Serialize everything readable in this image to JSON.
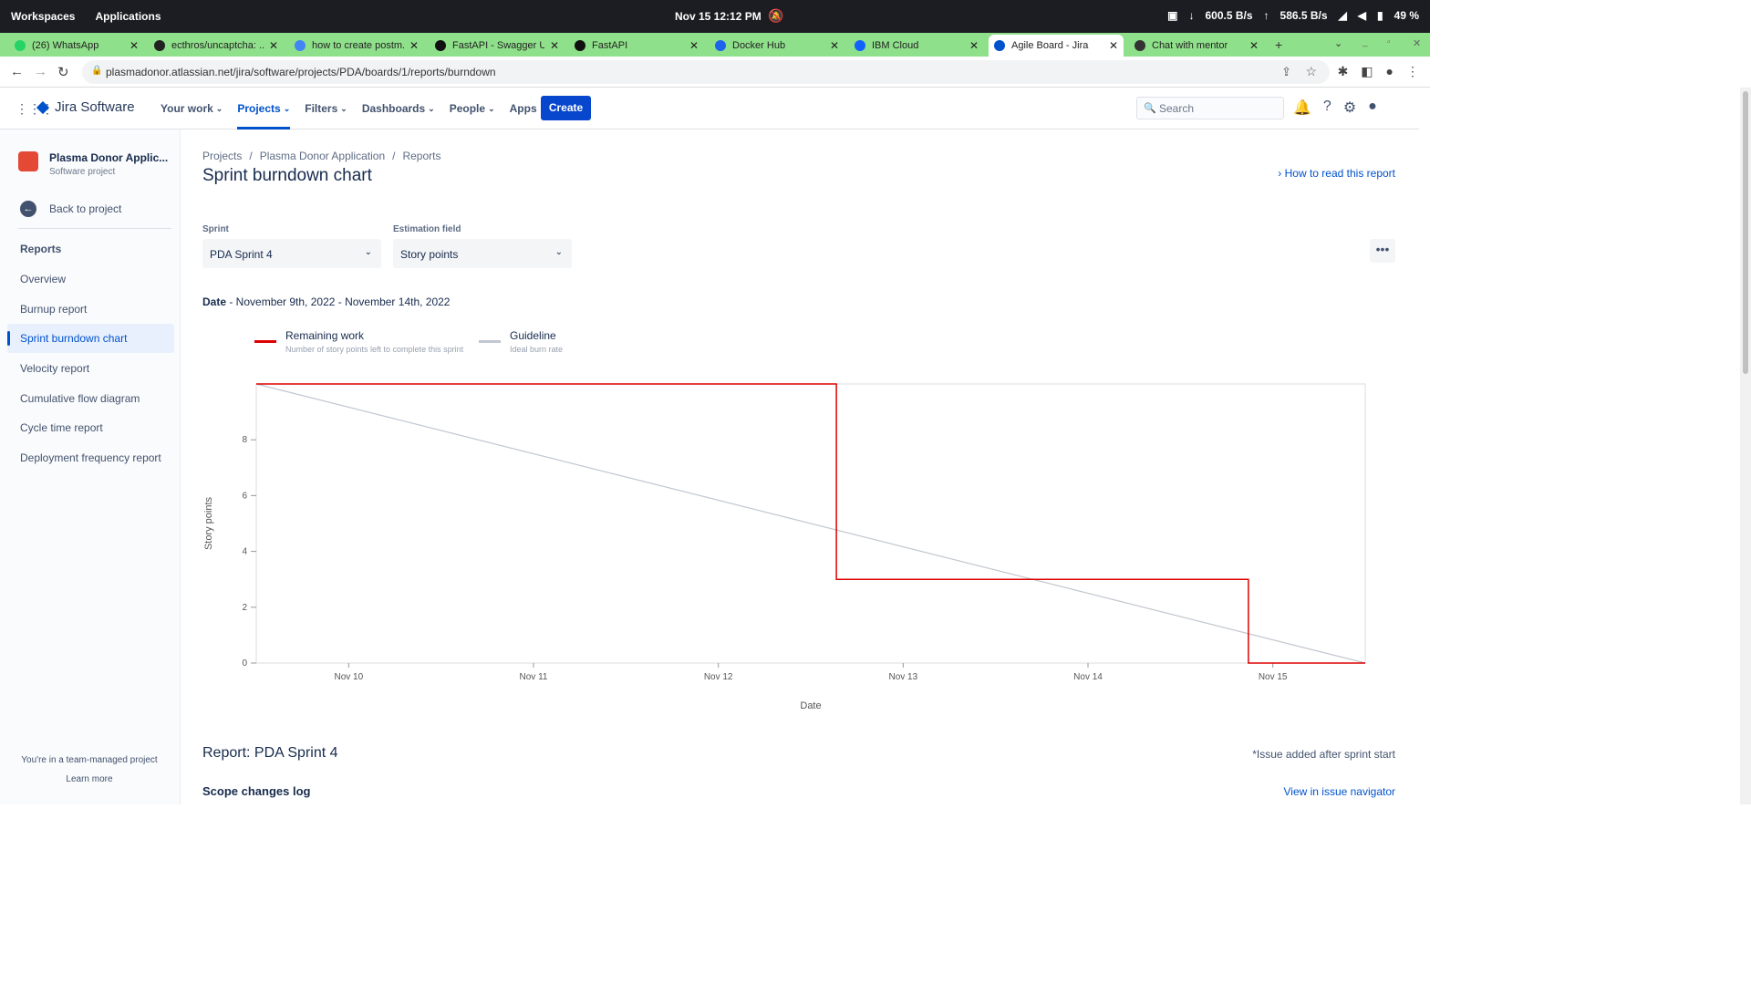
{
  "system": {
    "workspaces": "Workspaces",
    "applications": "Applications",
    "clock": "Nov 15  12:12 PM",
    "download": "600.5  B/s",
    "upload": "586.5  B/s",
    "battery": "49 %"
  },
  "tabs": [
    {
      "title": "(26) WhatsApp",
      "color": "#25d366"
    },
    {
      "title": "ecthros/uncaptcha: ...",
      "color": "#222222"
    },
    {
      "title": "how to create postm...",
      "color": "#4285f4"
    },
    {
      "title": "FastAPI - Swagger UI",
      "color": "#111111"
    },
    {
      "title": "FastAPI",
      "color": "#111111"
    },
    {
      "title": "Docker Hub",
      "color": "#1d63ed"
    },
    {
      "title": "IBM Cloud",
      "color": "#0f62fe"
    },
    {
      "title": "Agile Board - Jira",
      "color": "#0052cc"
    },
    {
      "title": "Chat with mentor",
      "color": "#333333"
    }
  ],
  "address": {
    "url": "plasmadonor.atlassian.net/jira/software/projects/PDA/boards/1/reports/burndown"
  },
  "jira_nav": {
    "product": "Jira Software",
    "menu": [
      {
        "label": "Your work",
        "active": false
      },
      {
        "label": "Projects",
        "active": true
      },
      {
        "label": "Filters",
        "active": false
      },
      {
        "label": "Dashboards",
        "active": false
      },
      {
        "label": "People",
        "active": false
      },
      {
        "label": "Apps",
        "active": false
      }
    ],
    "create": "Create",
    "search_placeholder": "Search"
  },
  "sidebar": {
    "project_name": "Plasma Donor Applic...",
    "project_type": "Software project",
    "back": "Back to project",
    "reports_heading": "Reports",
    "items": [
      {
        "label": "Overview",
        "active": false
      },
      {
        "label": "Burnup report",
        "active": false
      },
      {
        "label": "Sprint burndown chart",
        "active": true
      },
      {
        "label": "Velocity report",
        "active": false
      },
      {
        "label": "Cumulative flow diagram",
        "active": false
      },
      {
        "label": "Cycle time report",
        "active": false
      },
      {
        "label": "Deployment frequency report",
        "active": false
      }
    ],
    "footer_text": "You're in a team-managed project",
    "footer_link": "Learn more"
  },
  "main": {
    "breadcrumbs": [
      "Projects",
      "Plasma Donor Application",
      "Reports"
    ],
    "title": "Sprint burndown chart",
    "how_to": "How to read this report",
    "sprint_label": "Sprint",
    "sprint_value": "PDA Sprint 4",
    "estimation_label": "Estimation field",
    "estimation_value": "Story points",
    "date_label": "Date",
    "date_range": " - November 9th, 2022 - November 14th, 2022",
    "legend": [
      {
        "title": "Remaining work",
        "subtitle": "Number of story points left to complete this sprint",
        "color": "#de0000"
      },
      {
        "title": "Guideline",
        "subtitle": "Ideal burn rate",
        "color": "#c1c7d0"
      }
    ],
    "report_title": "Report: PDA Sprint 4",
    "issue_note": "*Issue added after sprint start",
    "scope_heading": "Scope changes log",
    "view_link": "View in issue navigator"
  },
  "chart_data": {
    "type": "line",
    "xlabel": "Date",
    "ylabel": "Story points",
    "x_ticks": [
      "Nov 10",
      "Nov 11",
      "Nov 12",
      "Nov 13",
      "Nov 14",
      "Nov 15"
    ],
    "y_ticks": [
      0,
      2,
      4,
      6,
      8
    ],
    "ylim": [
      0,
      10
    ],
    "xlim": [
      "Nov 9 12:00",
      "Nov 15 12:00"
    ],
    "series": [
      {
        "name": "Remaining work",
        "color": "#de0000",
        "step": true,
        "points": [
          {
            "x": "Nov 9 12:00",
            "y": 10
          },
          {
            "x": "Nov 12 15:20",
            "y": 10
          },
          {
            "x": "Nov 12 15:20",
            "y": 3
          },
          {
            "x": "Nov 14 20:50",
            "y": 3
          },
          {
            "x": "Nov 14 20:50",
            "y": 0
          },
          {
            "x": "Nov 15 12:00",
            "y": 0
          }
        ]
      },
      {
        "name": "Guideline",
        "color": "#c1c7d0",
        "step": false,
        "points": [
          {
            "x": "Nov 9 12:00",
            "y": 10
          },
          {
            "x": "Nov 15 12:00",
            "y": 0
          }
        ]
      }
    ],
    "grid": false
  }
}
